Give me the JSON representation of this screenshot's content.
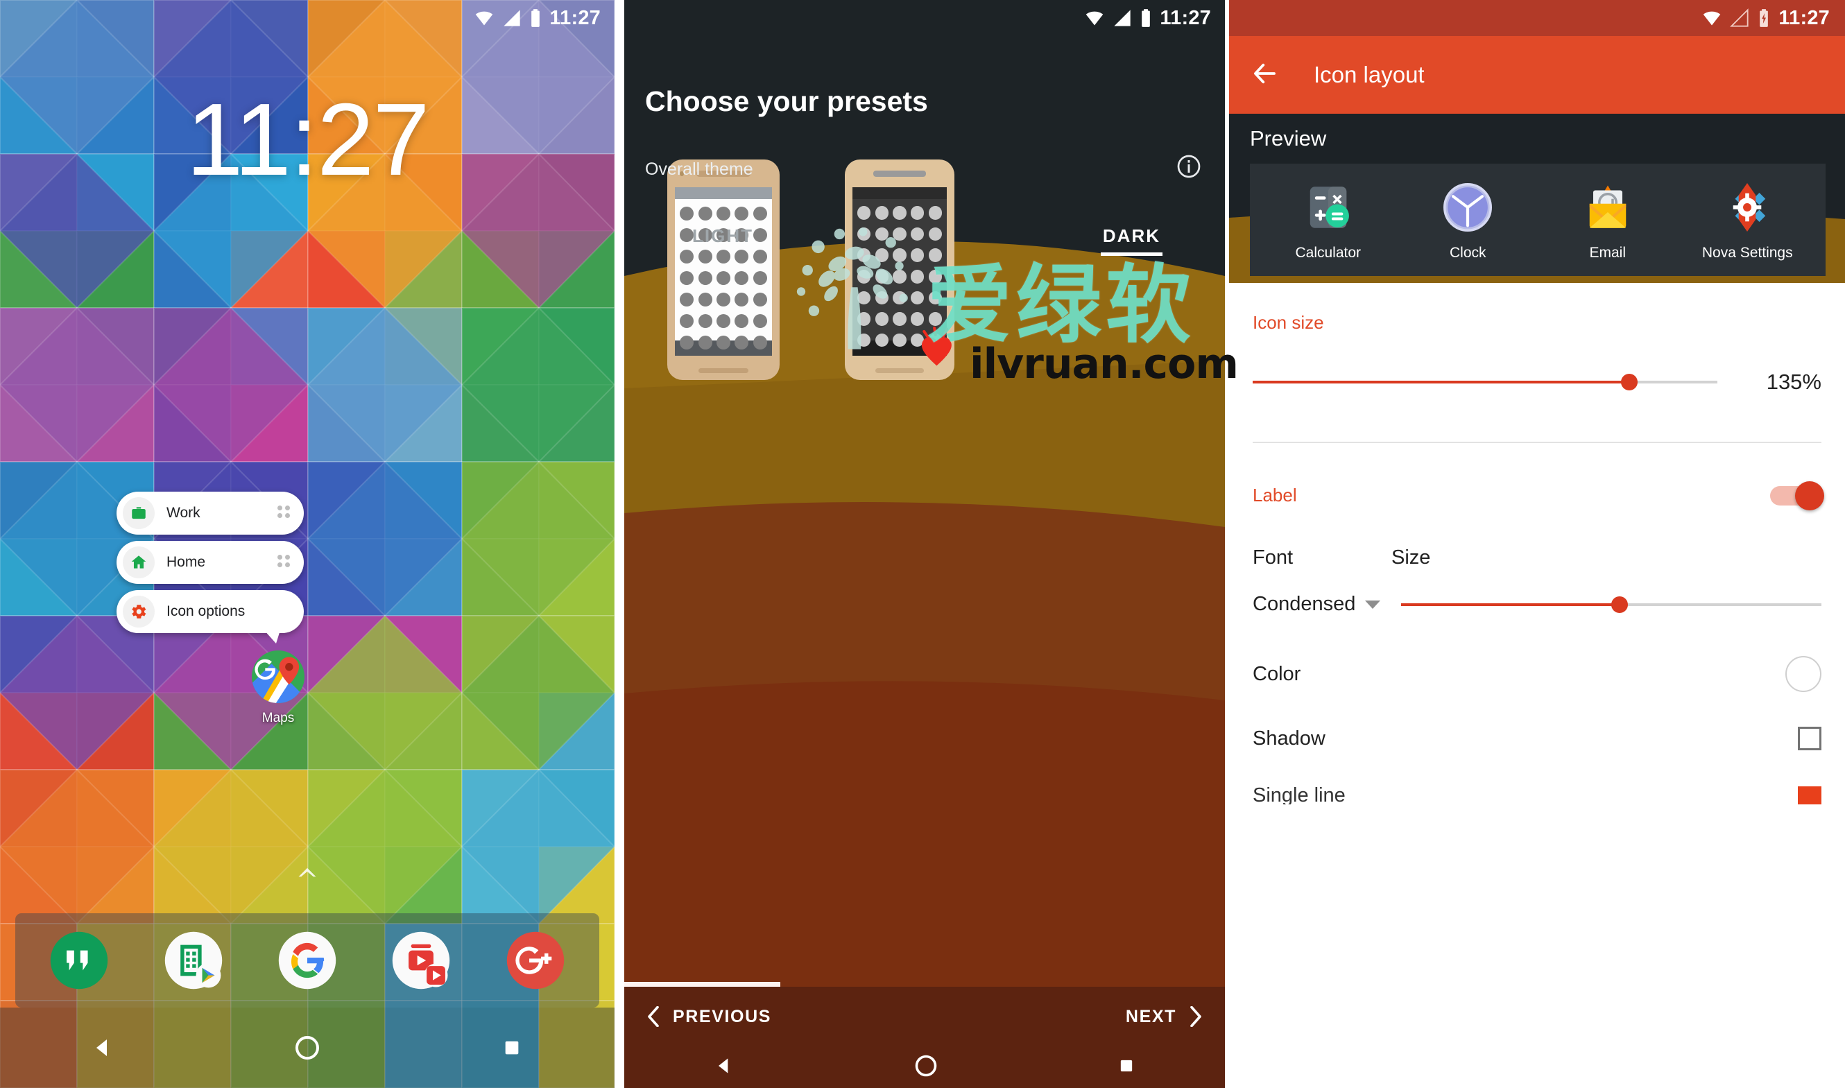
{
  "panels": {
    "home": {
      "name": "Android home screen",
      "statusbar": {
        "time": "11:27",
        "icons": [
          "wifi-icon",
          "signal-icon",
          "battery-icon"
        ]
      },
      "clock_widget": "11:27",
      "popup_menu": {
        "items": [
          {
            "label": "Work",
            "icon": "briefcase-icon",
            "icon_color": "#1ba94c",
            "handle": "drag-handle-icon"
          },
          {
            "label": "Home",
            "icon": "house-icon",
            "icon_color": "#1ba94c",
            "handle": "drag-handle-icon"
          },
          {
            "label": "Icon options",
            "icon": "gear-icon",
            "icon_color": "#e8401b",
            "handle": ""
          }
        ]
      },
      "app_icon": {
        "label": "Maps",
        "icon": "google-maps-icon"
      },
      "page_indicator": "^",
      "dock": [
        {
          "name": "Hangouts",
          "icon": "hangouts-icon"
        },
        {
          "name": "Sheets",
          "icon": "sheets-play-icon"
        },
        {
          "name": "Google",
          "icon": "google-g-icon"
        },
        {
          "name": "Play Music",
          "icon": "play-music-icon"
        },
        {
          "name": "Google Plus",
          "icon": "google-plus-icon"
        }
      ],
      "navbar": [
        "back-icon",
        "home-icon",
        "recents-icon"
      ]
    },
    "presets": {
      "statusbar": {
        "time": "11:27",
        "icons": [
          "wifi-icon",
          "signal-icon",
          "battery-icon"
        ]
      },
      "title": "Choose your presets",
      "subtitle": "Overall theme",
      "info_icon": "info-icon",
      "tabs": [
        {
          "label": "LIGHT",
          "selected": false
        },
        {
          "label": "DARK",
          "selected": true
        }
      ],
      "previews": [
        {
          "theme": "LIGHT",
          "screen_bg": "#fdfdfd",
          "dot_color": "#808080",
          "body_color": "#d7b78f"
        },
        {
          "theme": "DARK",
          "screen_bg": "#3a3a3a",
          "dot_color": "#c9c9c9",
          "body_color": "#e0c49c"
        }
      ],
      "progress_percent": 26,
      "nav": {
        "previous": "PREVIOUS",
        "next": "NEXT",
        "prev_icon": "chevron-left-icon",
        "next_icon": "chevron-right-icon"
      },
      "navbar": [
        "back-icon",
        "home-icon",
        "recents-icon"
      ]
    },
    "icon_layout": {
      "statusbar": {
        "time": "11:27",
        "icons": [
          "wifi-icon",
          "signal-empty-icon",
          "battery-charging-icon"
        ]
      },
      "appbar": {
        "back_icon": "arrow-back-icon",
        "title": "Icon layout"
      },
      "preview": {
        "section_label": "Preview",
        "apps": [
          {
            "label": "Calculator",
            "icon": "calculator-icon"
          },
          {
            "label": "Clock",
            "icon": "clock-icon"
          },
          {
            "label": "Email",
            "icon": "email-icon"
          },
          {
            "label": "Nova Settings",
            "icon": "nova-settings-icon"
          }
        ]
      },
      "settings": {
        "icon_size": {
          "label": "Icon size",
          "value": "135%",
          "slider_percent": 81
        },
        "label_section": {
          "label": "Label",
          "toggle_on": true
        },
        "font": {
          "label": "Font",
          "value": "Condensed",
          "caret": "chevron-down-icon"
        },
        "size": {
          "label": "Size",
          "slider_percent": 52
        },
        "color": {
          "label": "Color",
          "swatch": "color-circle"
        },
        "shadow": {
          "label": "Shadow",
          "checked": false
        },
        "partial_row": {
          "label": "",
          "checked": true
        }
      },
      "accent_color": "#e14a28"
    }
  },
  "watermark": {
    "chinese": "爱绿软",
    "url": "ilvruan.com",
    "logo": "tree-icon",
    "heart": "heart-icon"
  }
}
